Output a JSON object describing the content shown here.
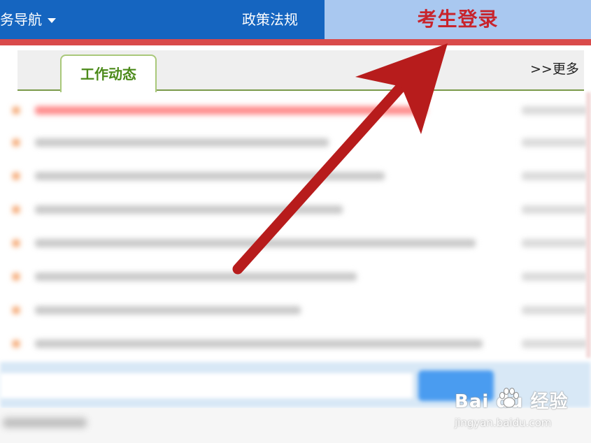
{
  "nav": {
    "services_label": "务导航",
    "policy_label": "政策法规",
    "login_label": "考生登录"
  },
  "tabs": {
    "active_label": "工作动态",
    "more_label": ">>更多"
  },
  "watermark": {
    "brand_text": "Bai du 经验",
    "url_text": "jingyan.baidu.com"
  },
  "colors": {
    "nav_bg": "#1565c0",
    "login_bg": "#a9c8f0",
    "login_text": "#c8242c",
    "arrow": "#b71c1c",
    "tab_text": "#4c8a1a"
  }
}
